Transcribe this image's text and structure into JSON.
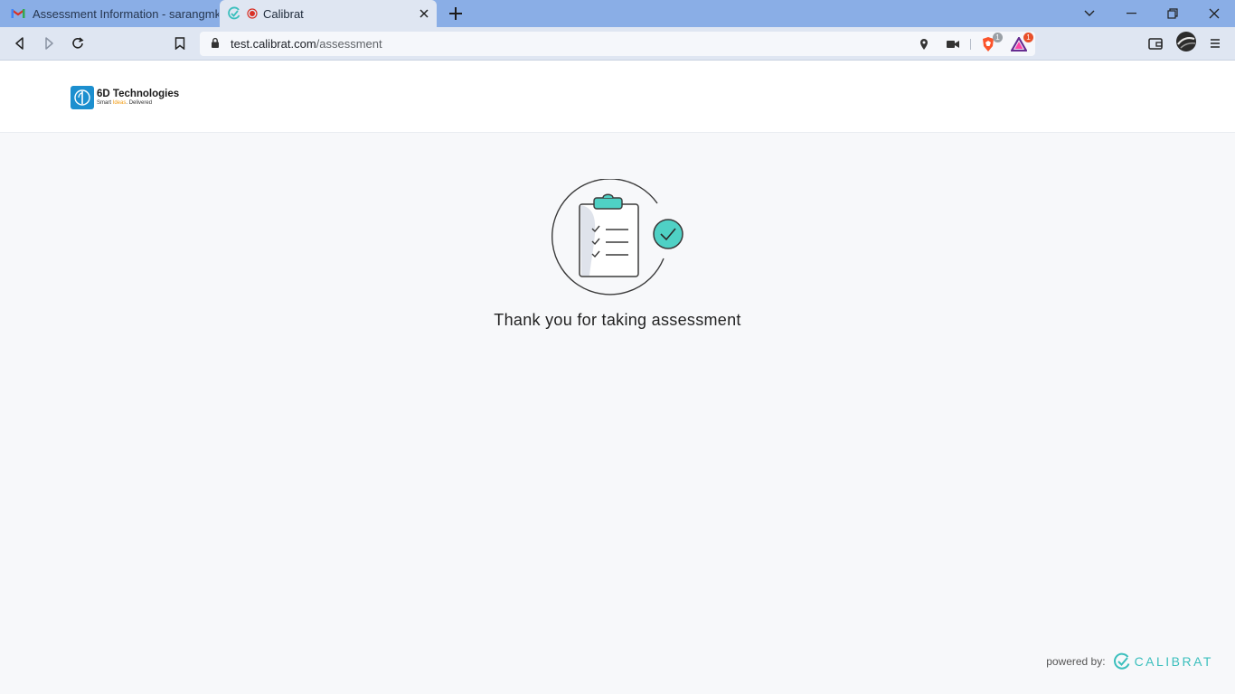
{
  "browser": {
    "tabs": [
      {
        "title": "Assessment Information - sarangmk.m",
        "icon": "gmail-icon"
      },
      {
        "title": "Calibrat",
        "icon": "calibrat-icon"
      }
    ],
    "url_host": "test.calibrat.com",
    "url_path": "/assessment",
    "shields_badge": "1",
    "rewards_badge": "1"
  },
  "header": {
    "logo_name": "6D Technologies",
    "logo_tag_start": "Smart ",
    "logo_tag_mid": "Ideas",
    "logo_tag_end": ". Delivered"
  },
  "main": {
    "message": "Thank you for taking assessment"
  },
  "footer": {
    "powered_label": "powered by:",
    "brand": "CALIBRAT"
  },
  "colors": {
    "accent": "#3bbfbd",
    "tabstrip": "#8aaee6",
    "logo_blue": "#1c8fcf"
  }
}
